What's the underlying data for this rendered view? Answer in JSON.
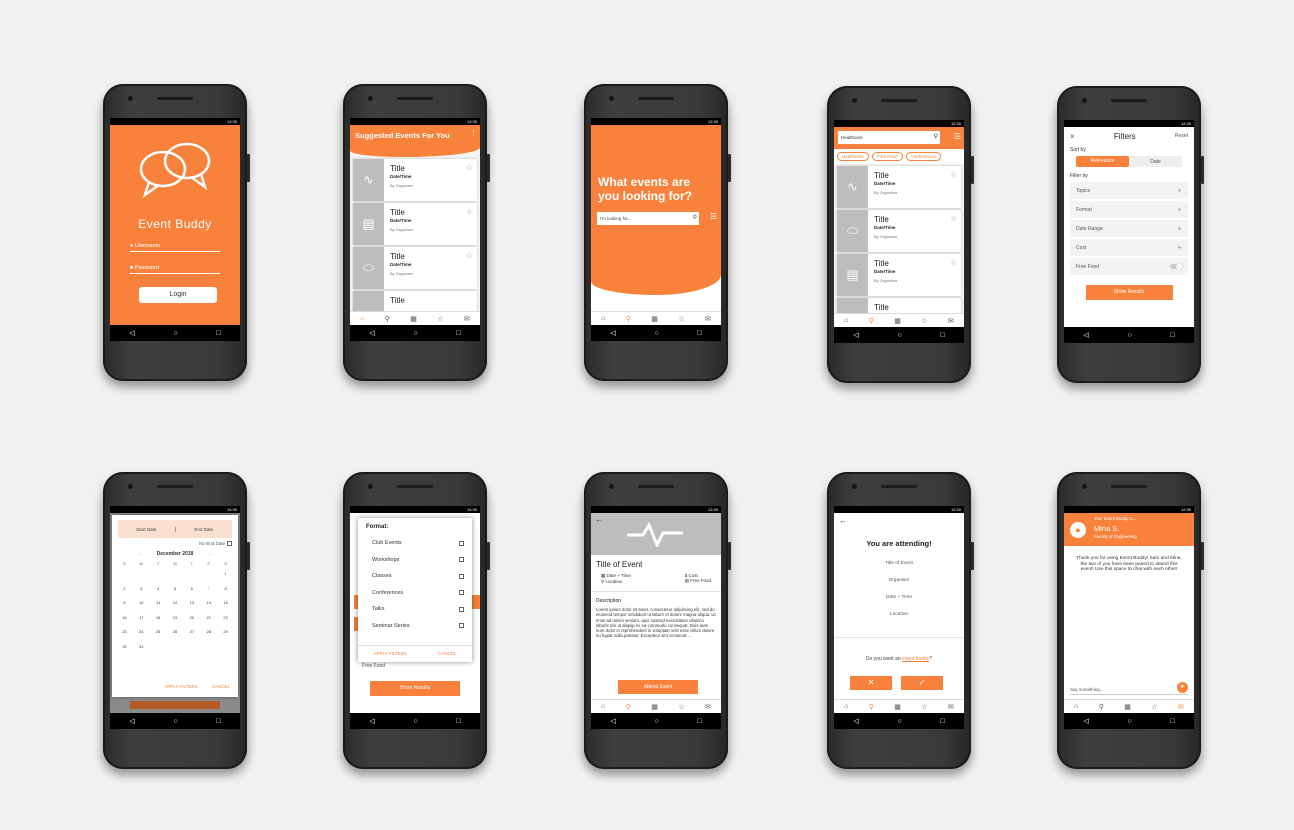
{
  "status_time": "12:30",
  "nav": {
    "back": "◁",
    "home": "○",
    "recent": "□"
  },
  "tabs": {
    "home": "⌂",
    "search": "⚲",
    "calendar": "▦",
    "favorites": "☆",
    "chat": "✉"
  },
  "login": {
    "app_name": "Event Buddy",
    "username_label": "Username",
    "password_label": "Password",
    "login_button": "Login"
  },
  "suggested": {
    "header": "Suggested Events For You",
    "cards": [
      {
        "icon": "∿",
        "title": "Title",
        "datetime": "Date/Time",
        "organizer": "By Organizer"
      },
      {
        "icon": "▤",
        "title": "Title",
        "datetime": "Date/Time",
        "organizer": "By Organizer"
      },
      {
        "icon": "⬭",
        "title": "Title",
        "datetime": "Date/Time",
        "organizer": "By Organizer"
      },
      {
        "icon": "",
        "title": "Title",
        "datetime": "",
        "organizer": ""
      }
    ]
  },
  "search": {
    "headline": "What events are you looking for?",
    "placeholder": "I'm looking for..."
  },
  "results": {
    "query": "Healthcare",
    "chips": [
      "Healthcare",
      "Free Food",
      "Conferences"
    ],
    "cards": [
      {
        "icon": "∿",
        "title": "Title",
        "datetime": "Date/Time",
        "organizer": "By Organizer"
      },
      {
        "icon": "⬭",
        "title": "Title",
        "datetime": "Date/Time",
        "organizer": "By Organizer"
      },
      {
        "icon": "▤",
        "title": "Title",
        "datetime": "Date/Time",
        "organizer": "By Organizer"
      },
      {
        "icon": "",
        "title": "Title",
        "datetime": "",
        "organizer": ""
      }
    ]
  },
  "filters": {
    "close": "×",
    "title": "Filters",
    "reset": "Reset",
    "sort_by": "Sort by",
    "sort_relevance": "Relevance",
    "sort_date": "Date",
    "filter_by": "Filter by",
    "rows": [
      "Topics",
      "Format",
      "Date Range",
      "Cost"
    ],
    "free_food": "Free Food",
    "show_results": "Show Results"
  },
  "calendar": {
    "start_date": "Start Date",
    "end_date": "End Date",
    "no_end_date": "No End Date",
    "month": "December 2018",
    "weekdays": [
      "S",
      "M",
      "T",
      "W",
      "T",
      "F",
      "S"
    ],
    "weeks": [
      [
        "",
        "",
        "",
        "",
        "",
        "",
        "1"
      ],
      [
        "2",
        "3",
        "4",
        "5",
        "6",
        "7",
        "8"
      ],
      [
        "9",
        "10",
        "11",
        "12",
        "13",
        "14",
        "15"
      ],
      [
        "16",
        "17",
        "18",
        "19",
        "20",
        "21",
        "22"
      ],
      [
        "23",
        "24",
        "25",
        "26",
        "27",
        "28",
        "29"
      ],
      [
        "30",
        "31",
        "",
        "",
        "",
        "",
        ""
      ]
    ],
    "highlight_day": "7",
    "apply": "APPLY FILTERS",
    "cancel": "CANCEL"
  },
  "format_dialog": {
    "title": "Format:",
    "options": [
      "Club Events",
      "Workshops",
      "Classes",
      "Conferences",
      "Talks",
      "Seminar Series"
    ],
    "apply": "APPLY FILTERS",
    "cancel": "CANCEL",
    "bg_free_food": "Free Food",
    "bg_show_results": "Show Results"
  },
  "event_detail": {
    "title": "Title of Event",
    "datetime": "Date + Time",
    "location": "Location",
    "cost": "Cost",
    "free_food": "Free Food",
    "description_label": "Description",
    "description": "Lorem ipsum dolor sit amet, consectetur adipiscing elit, sed do eiusmod tempor incididunt ut labore et dolore magna aliqua. Ut enim ad minim veniam, quis nostrud exercitation ullamco laboris nisi ut aliquip ex ea commodo consequat. Duis aute irure dolor in reprehenderit in voluptate velit esse cillum dolore eu fugiat nulla pariatur. Excepteur sint occaecat ...",
    "attend_button": "Attend Event"
  },
  "attending": {
    "headline": "You are attending!",
    "items": [
      "Title of Event",
      "Organiser",
      "Date + Time",
      "Location"
    ],
    "question_prefix": "Do you want an ",
    "question_link": "event buddy",
    "question_suffix": "?",
    "no": "✕",
    "yes": "✓"
  },
  "chat": {
    "your_buddy_is": "Your Event Buddy is...",
    "buddy_name": "Mina S.",
    "buddy_faculty": "Faculty of Engineering",
    "message": "Thank you for using Event Buddy! Sam and Mina, the two of you have been paired to attend this event! Use this space to chat with each other!",
    "input_placeholder": "Say something..."
  }
}
